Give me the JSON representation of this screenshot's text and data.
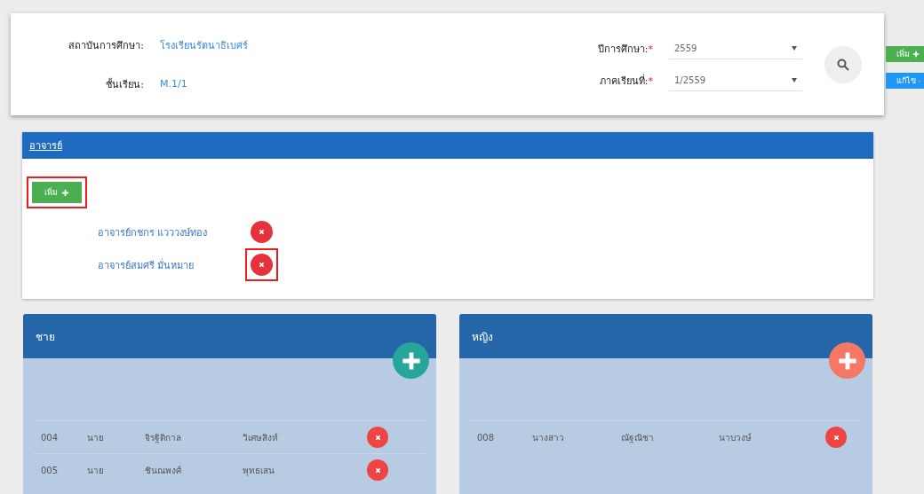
{
  "filter": {
    "fields": [
      {
        "label": "สถาบันการศึกษา:",
        "value": "โรงเรียนรัตนาธิเบศร์"
      },
      {
        "label": "ชั้นเรียน:",
        "value": "M.1/1"
      }
    ],
    "selects": [
      {
        "label": "ปีการศึกษา:",
        "required": true,
        "value": "2559"
      },
      {
        "label": "ภาคเรียนที่:",
        "required": true,
        "value": "1/2559"
      }
    ],
    "required_mark": "*"
  },
  "side_buttons": [
    {
      "kind": "add",
      "label": "เพิ่ม"
    },
    {
      "kind": "edit",
      "label": "แก้ไข"
    }
  ],
  "teacher_panel": {
    "title": "อาจารย์",
    "add_button": {
      "label": "เพิ่ม",
      "highlighted": true
    },
    "teachers": [
      {
        "name": "อาจารย์กชกร แวววงษ์ทอง",
        "highlighted": false
      },
      {
        "name": "อาจารย์สมศรี มั่นหมาย",
        "highlighted": true
      }
    ]
  },
  "groups": [
    {
      "kind": "male",
      "title": "ชาย",
      "students": [
        {
          "code": "004",
          "prefix": "นาย",
          "first_name": "จิรฐิติกาล",
          "last_name": "วิเศษสิงห์"
        },
        {
          "code": "005",
          "prefix": "นาย",
          "first_name": "ชินณพงศ์",
          "last_name": "พุทธเสน"
        }
      ]
    },
    {
      "kind": "female",
      "title": "หญิง",
      "students": [
        {
          "code": "008",
          "prefix": "นางสาว",
          "first_name": "ณัฐณิชา",
          "last_name": "นาบวงษ์"
        }
      ]
    }
  ]
}
